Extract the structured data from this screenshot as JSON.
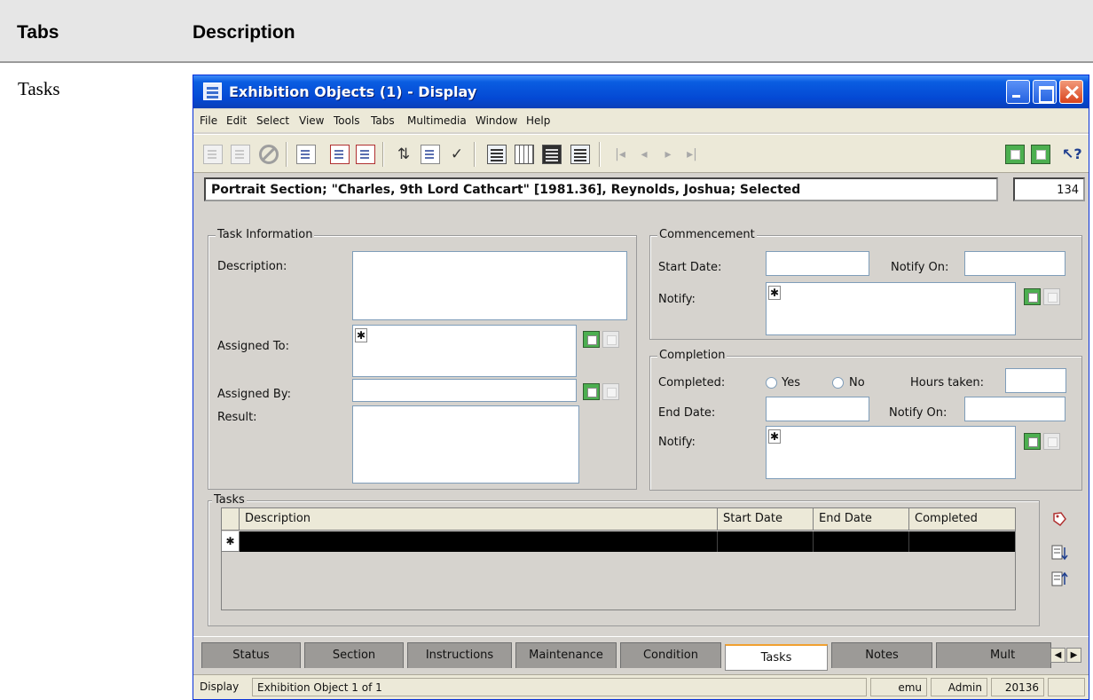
{
  "doc_table": {
    "headers": [
      "Tabs",
      "Description"
    ],
    "row_label": "Tasks"
  },
  "window": {
    "title": "Exhibition Objects (1) - Display",
    "menu": [
      "File",
      "Edit",
      "Select",
      "View",
      "Tools",
      "Tabs",
      "Multimedia",
      "Window",
      "Help"
    ],
    "toolbar_icons": [
      "new-record-icon",
      "save-icon",
      "cancel-icon",
      "new-window-icon",
      "copy-record-icon",
      "delete-record-icon",
      "sort-icon",
      "attach-icon",
      "spell-check-icon",
      "details-view-icon",
      "list-view-icon",
      "page-view-icon",
      "form-view-icon",
      "first-record-icon",
      "previous-record-icon",
      "next-record-icon",
      "last-record-icon",
      "lookup-icon",
      "notes-icon",
      "help-pointer-icon"
    ],
    "summary": "Portrait Section; \"Charles, 9th Lord Cathcart\" [1981.36], Reynolds, Joshua; Selected",
    "record_count": "134",
    "task_info": {
      "title": "Task Information",
      "description_label": "Description:",
      "description_value": "",
      "assigned_to_label": "Assigned To:",
      "assigned_to_value": "",
      "assigned_by_label": "Assigned By:",
      "assigned_by_value": "",
      "result_label": "Result:",
      "result_value": ""
    },
    "commencement": {
      "title": "Commencement",
      "start_date_label": "Start Date:",
      "start_date_value": "",
      "notify_on_label": "Notify On:",
      "notify_on_value": "",
      "notify_label": "Notify:",
      "notify_value": ""
    },
    "completion": {
      "title": "Completion",
      "completed_label": "Completed:",
      "yes_label": "Yes",
      "no_label": "No",
      "hours_taken_label": "Hours taken:",
      "hours_taken_value": "",
      "end_date_label": "End Date:",
      "end_date_value": "",
      "notify_on_label": "Notify On:",
      "notify_on_value": "",
      "notify_label": "Notify:",
      "notify_value": ""
    },
    "tasks_grid": {
      "title": "Tasks",
      "columns": [
        "Description",
        "Start Date",
        "End Date",
        "Completed"
      ],
      "rows": []
    },
    "tabs": [
      "Status",
      "Section",
      "Instructions",
      "Maintenance",
      "Condition",
      "Tasks",
      "Notes",
      "Mult"
    ],
    "active_tab": "Tasks",
    "status_bar": {
      "mode": "Display",
      "record_position": "Exhibition Object 1 of 1",
      "database": "emu",
      "user": "Admin",
      "record_id": "20136"
    }
  }
}
